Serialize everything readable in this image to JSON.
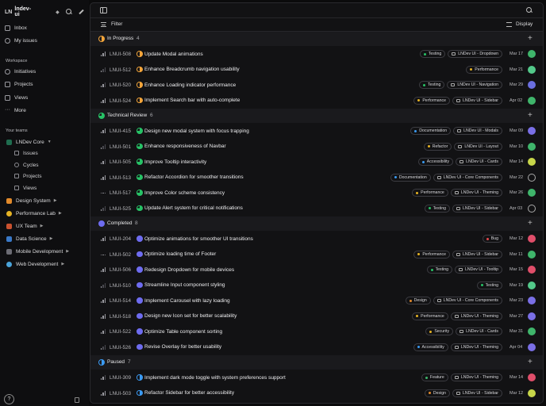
{
  "workspace": {
    "logo": "LN",
    "name": "lndev-ui"
  },
  "sidebar": {
    "top": [
      {
        "label": "Inbox",
        "icon": "inbox-icon"
      },
      {
        "label": "My issues",
        "icon": "issues-icon"
      }
    ],
    "workspace_label": "Workspace",
    "workspace_items": [
      {
        "label": "Initiatives",
        "icon": "initiatives-icon"
      },
      {
        "label": "Projects",
        "icon": "projects-icon"
      },
      {
        "label": "Views",
        "icon": "views-icon"
      },
      {
        "label": "More",
        "icon": "more-icon"
      }
    ],
    "teams_label": "Your teams",
    "teams": [
      {
        "label": "LNDev Core",
        "color": "#1f6d4f"
      },
      {
        "label": "Design System",
        "color": "#e28a2b"
      },
      {
        "label": "Performance Lab",
        "color": "#e6b324"
      },
      {
        "label": "UX Team",
        "color": "#c9512f"
      },
      {
        "label": "Data Science",
        "color": "#3a79c8"
      },
      {
        "label": "Mobile Development",
        "color": "#6c6c74"
      },
      {
        "label": "Web Development",
        "color": "#4aa3d9"
      }
    ],
    "core_sub": [
      "Issues",
      "Cycles",
      "Projects",
      "Views"
    ],
    "help": "?"
  },
  "toolbar": {
    "filter": "Filter",
    "display": "Display"
  },
  "groups": [
    {
      "name": "In Progress",
      "count": "4",
      "status": "prog",
      "color": "#f2a43a",
      "rows": [
        {
          "id": "LNUI-508",
          "prio": "bars3",
          "title": "Update Modal animations",
          "tags": [
            {
              "t": "Testing",
              "c": "#27c266"
            },
            {
              "t": "LNDev UI - Dropdown",
              "p": true
            }
          ],
          "date": "Mar 17",
          "av": "#3fb56b"
        },
        {
          "id": "LNUI-512",
          "prio": "bars1",
          "title": "Enhance Breadcrumb navigation usability",
          "tags": [
            {
              "t": "Performance",
              "c": "#e6b324"
            }
          ],
          "date": "Mar 21",
          "av": "#53c98a"
        },
        {
          "id": "LNUI-520",
          "prio": "bars2",
          "title": "Enhance Loading indicator performance",
          "tags": [
            {
              "t": "Testing",
              "c": "#27c266"
            },
            {
              "t": "LNDev UI - Navigation",
              "p": true
            }
          ],
          "date": "Mar 29",
          "av": "#6b6fe0"
        },
        {
          "id": "LNUI-524",
          "prio": "bars3",
          "title": "Implement Search bar with auto-complete",
          "tags": [
            {
              "t": "Performance",
              "c": "#e6b324"
            },
            {
              "t": "LNDev UI - Sidebar",
              "p": true
            }
          ],
          "date": "Apr 02",
          "av": "#3fb56b"
        }
      ]
    },
    {
      "name": "Technical Review",
      "count": "6",
      "status": "rev",
      "color": "#27c266",
      "rows": [
        {
          "id": "LNUI-415",
          "prio": "bars3",
          "title": "Design new modal system with focus trapping",
          "tags": [
            {
              "t": "Documentation",
              "c": "#3b9af2"
            },
            {
              "t": "LNDev UI - Modals",
              "p": true
            }
          ],
          "date": "Mar 09",
          "av": "#7a6fe6"
        },
        {
          "id": "LNUI-501",
          "prio": "bars1",
          "title": "Enhance responsiveness of Navbar",
          "tags": [
            {
              "t": "Refactor",
              "c": "#e6b324"
            },
            {
              "t": "LNDev UI - Layout",
              "p": true
            }
          ],
          "date": "Mar 10",
          "av": "#3fb56b"
        },
        {
          "id": "LNUI-505",
          "prio": "bars2",
          "title": "Improve Tooltip interactivity",
          "tags": [
            {
              "t": "Accessibility",
              "c": "#3b9af2"
            },
            {
              "t": "LNDev UI - Cards",
              "p": true
            }
          ],
          "date": "Mar 14",
          "av": "#c7d64a"
        },
        {
          "id": "LNUI-513",
          "prio": "bars3",
          "title": "Refactor Accordion for smoother transitions",
          "tags": [
            {
              "t": "Documentation",
              "c": "#3b9af2"
            },
            {
              "t": "LNDev UI - Core Components",
              "p": true
            }
          ],
          "date": "Mar 22",
          "av": "empty"
        },
        {
          "id": "LNUI-517",
          "prio": "dots",
          "title": "Improve Color scheme consistency",
          "tags": [
            {
              "t": "Performance",
              "c": "#e6b324"
            },
            {
              "t": "LNDev UI - Theming",
              "p": true
            }
          ],
          "date": "Mar 26",
          "av": "#3fb56b"
        },
        {
          "id": "LNUI-525",
          "prio": "bars1",
          "title": "Update Alert system for critical notifications",
          "tags": [
            {
              "t": "Testing",
              "c": "#27c266"
            },
            {
              "t": "LNDev UI - Sidebar",
              "p": true
            }
          ],
          "date": "Apr 03",
          "av": "empty"
        }
      ]
    },
    {
      "name": "Completed",
      "count": "8",
      "status": "done",
      "color": "#6e6cf0",
      "rows": [
        {
          "id": "LNUI-204",
          "prio": "bars3",
          "title": "Optimize animations for smoother UI transitions",
          "tags": [
            {
              "t": "Bug",
              "c": "#e5484d"
            }
          ],
          "date": "Mar 12",
          "av": "#e04e6a"
        },
        {
          "id": "LNUI-502",
          "prio": "dots",
          "title": "Optimize loading time of Footer",
          "tags": [
            {
              "t": "Performance",
              "c": "#e6b324"
            },
            {
              "t": "LNDev UI - Sidebar",
              "p": true
            }
          ],
          "date": "Mar 11",
          "av": "#3fb56b"
        },
        {
          "id": "LNUI-506",
          "prio": "bars3",
          "title": "Redesign Dropdown for mobile devices",
          "tags": [
            {
              "t": "Testing",
              "c": "#27c266"
            },
            {
              "t": "LNDev UI - Tooltip",
              "p": true
            }
          ],
          "date": "Mar 15",
          "av": "#e04e6a"
        },
        {
          "id": "LNUI-510",
          "prio": "bars1",
          "title": "Streamline Input component styling",
          "tags": [
            {
              "t": "Testing",
              "c": "#27c266"
            }
          ],
          "date": "Mar 19",
          "av": "#53c98a"
        },
        {
          "id": "LNUI-514",
          "prio": "bars3",
          "title": "Implement Carousel with lazy loading",
          "tags": [
            {
              "t": "Design",
              "c": "#e28a2b"
            },
            {
              "t": "LNDev UI - Core Components",
              "p": true
            }
          ],
          "date": "Mar 23",
          "av": "#7a6fe6"
        },
        {
          "id": "LNUI-518",
          "prio": "bars3",
          "title": "Design new Icon set for better scalability",
          "tags": [
            {
              "t": "Performance",
              "c": "#e6b324"
            },
            {
              "t": "LNDev UI - Theming",
              "p": true
            }
          ],
          "date": "Mar 27",
          "av": "#7a6fe6"
        },
        {
          "id": "LNUI-522",
          "prio": "bars2",
          "title": "Optimize Table component sorting",
          "tags": [
            {
              "t": "Security",
              "c": "#e6b324"
            },
            {
              "t": "LNDev UI - Cards",
              "p": true
            }
          ],
          "date": "Mar 31",
          "av": "#3fb56b"
        },
        {
          "id": "LNUI-526",
          "prio": "bars1",
          "title": "Revise Overlay for better usability",
          "tags": [
            {
              "t": "Accessibility",
              "c": "#3b9af2"
            },
            {
              "t": "LNDev UI - Theming",
              "p": true
            }
          ],
          "date": "Apr 04",
          "av": "#7a6fe6"
        }
      ]
    },
    {
      "name": "Paused",
      "count": "7",
      "status": "paus",
      "color": "#3b9af2",
      "rows": [
        {
          "id": "LNUI-309",
          "prio": "bars2",
          "title": "Implement dark mode toggle with system preferences support",
          "tags": [
            {
              "t": "Feature",
              "c": "#3fb56b"
            },
            {
              "t": "LNDev UI - Theming",
              "p": true
            }
          ],
          "date": "Mar 14",
          "av": "#e04e6a"
        },
        {
          "id": "LNUI-503",
          "prio": "bars3",
          "title": "Refactor Sidebar for better accessibility",
          "tags": [
            {
              "t": "Design",
              "c": "#e28a2b"
            },
            {
              "t": "LNDev UI - Sidebar",
              "p": true
            }
          ],
          "date": "Mar 12",
          "av": "#c7d64a"
        }
      ]
    }
  ]
}
